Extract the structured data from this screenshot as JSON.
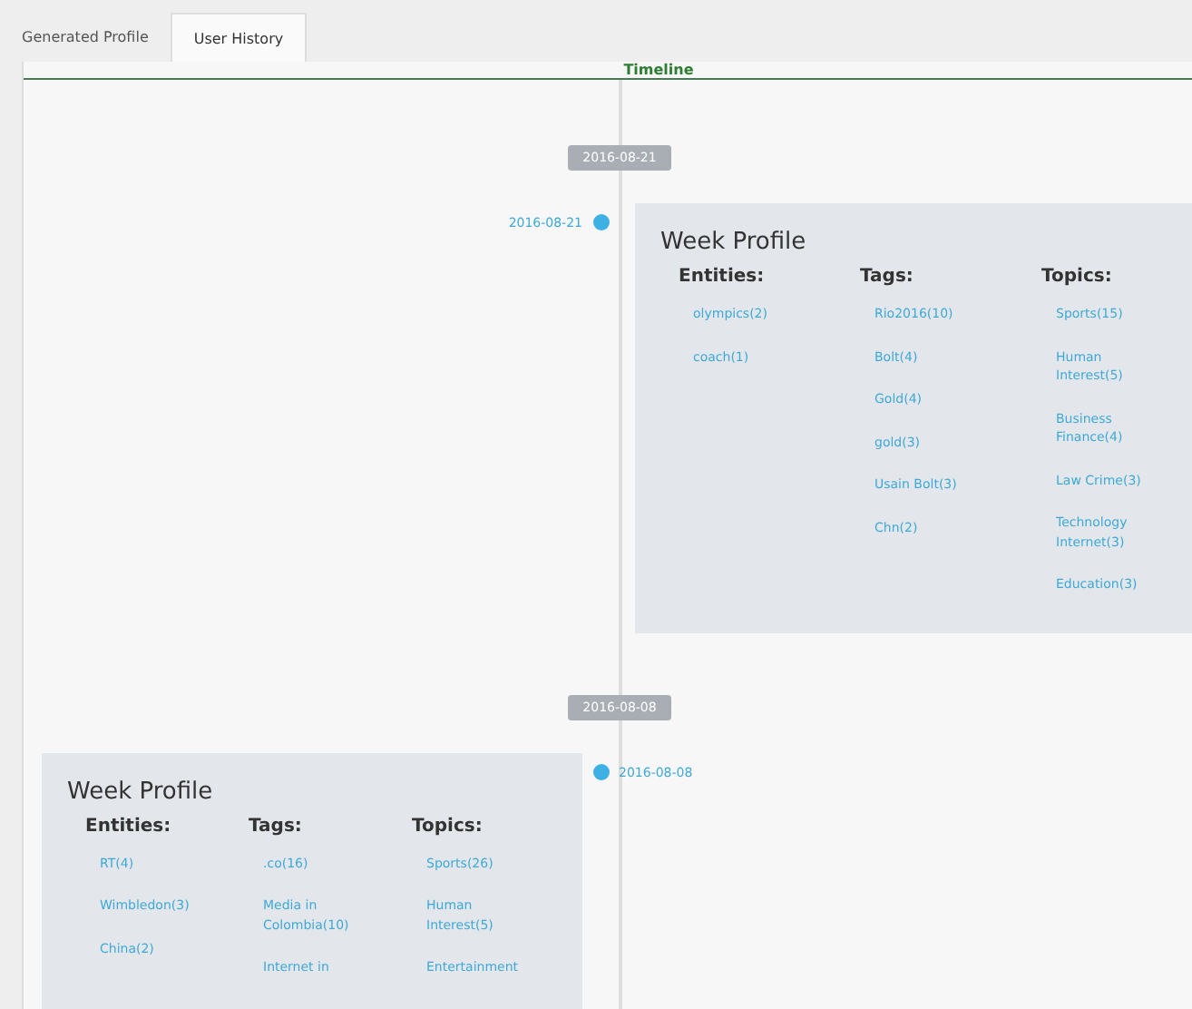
{
  "tabs": [
    {
      "label": "Generated Profile",
      "selected": false
    },
    {
      "label": "User History",
      "selected": true
    }
  ],
  "timeline": {
    "title": "Timeline",
    "entries": [
      {
        "badge": "2016-08-21",
        "date": "2016-08-21",
        "kind": "right",
        "card": {
          "title": "Week Profile",
          "columns": [
            {
              "heading": "Entities:",
              "items": [
                "olympics(2)",
                "coach(1)"
              ]
            },
            {
              "heading": "Tags:",
              "items": [
                "Rio2016(10)",
                "Bolt(4)",
                "Gold(4)",
                "gold(3)",
                "Usain Bolt(3)",
                "Chn(2)"
              ]
            },
            {
              "heading": "Topics:",
              "items": [
                "Sports(15)",
                "Human Interest(5)",
                "Business Finance(4)",
                "Law Crime(3)",
                "Technology Internet(3)",
                "Education(3)"
              ]
            }
          ]
        }
      },
      {
        "badge": "2016-08-08",
        "date": "2016-08-08",
        "kind": "left",
        "card": {
          "title": "Week Profile",
          "columns": [
            {
              "heading": "Entities:",
              "items": [
                "RT(4)",
                "Wimbledon(3)",
                "China(2)"
              ]
            },
            {
              "heading": "Tags:",
              "items": [
                ".co(16)",
                "Media in Colombia(10)",
                "Internet in"
              ]
            },
            {
              "heading": "Topics:",
              "items": [
                "Sports(26)",
                "Human Interest(5)",
                "Entertainment"
              ]
            }
          ]
        }
      }
    ]
  }
}
